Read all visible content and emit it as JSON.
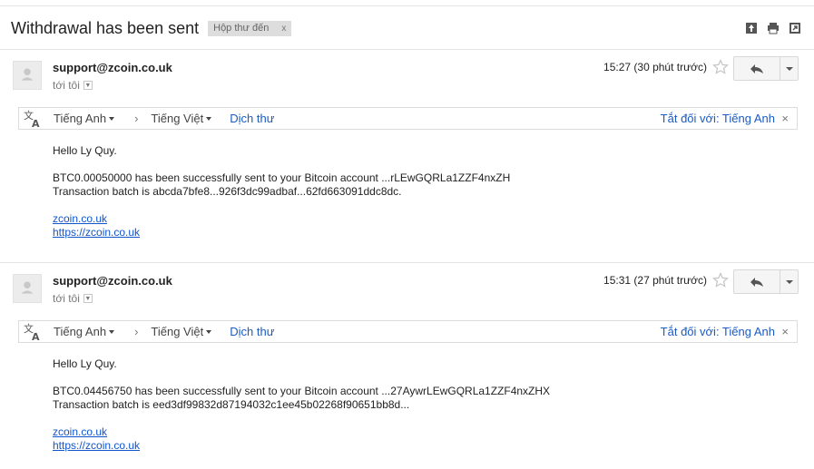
{
  "subject": "Withdrawal has been sent",
  "label": {
    "name": "Hộp thư đến",
    "remove": "x"
  },
  "toolbar_icons": [
    "archive-icon",
    "print-icon",
    "new-window-icon"
  ],
  "messages": [
    {
      "sender": "support@zcoin.co.uk",
      "to": "tới tôi",
      "time": "15:27 (30 phút trước)",
      "translate": {
        "from": "Tiếng Anh",
        "arrow": "›",
        "to": "Tiếng Việt",
        "action": "Dịch thư",
        "off": "Tắt đối với: Tiếng Anh",
        "close": "×"
      },
      "greeting": "Hello Ly Quy.",
      "line1": "BTC0.00050000 has been successfully sent to your Bitcoin account ...rLEwGQRLa1ZZF4nxZH",
      "line2": "Transaction batch is abcda7bfe8...926f3dc99adbaf...62fd663091ddc8dc.",
      "link1": "zcoin.co.uk",
      "link2": "https://zcoin.co.uk"
    },
    {
      "sender": "support@zcoin.co.uk",
      "to": "tới tôi",
      "time": "15:31 (27 phút trước)",
      "translate": {
        "from": "Tiếng Anh",
        "arrow": "›",
        "to": "Tiếng Việt",
        "action": "Dịch thư",
        "off": "Tắt đối với: Tiếng Anh",
        "close": "×"
      },
      "greeting": "Hello Ly Quy.",
      "line1": "BTC0.04456750 has been successfully sent to your Bitcoin account ...27AywrLEwGQRLa1ZZF4nxZHX",
      "line2": "Transaction batch is eed3df99832d87194032c1ee45b02268f90651bb8d...",
      "link1": "zcoin.co.uk",
      "link2": "https://zcoin.co.uk"
    }
  ]
}
